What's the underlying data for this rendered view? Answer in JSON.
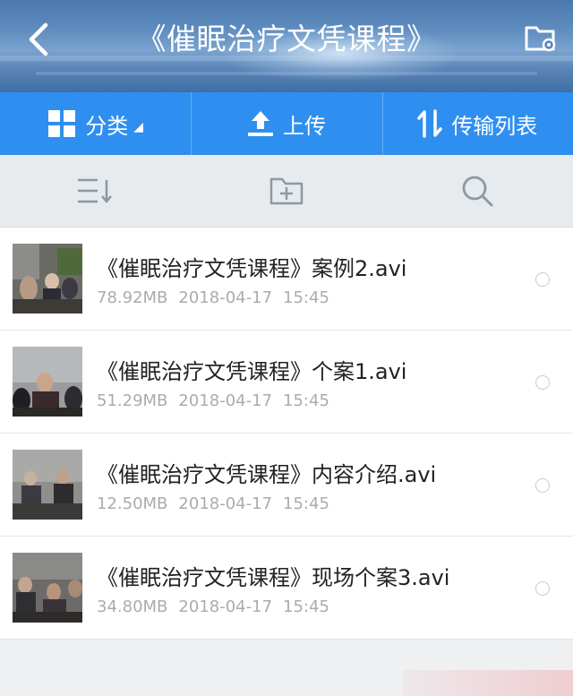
{
  "header": {
    "title": "《催眠治疗文凭课程》"
  },
  "toolbar": {
    "category_label": "分类",
    "upload_label": "上传",
    "transfer_label": "传输列表"
  },
  "colors": {
    "toolbar_bg": "#2f8ff0",
    "icon_gray": "#8a9aa6"
  },
  "files": [
    {
      "name": "《催眠治疗文凭课程》案例2.avi",
      "size": "78.92MB",
      "date": "2018-04-17",
      "time": "15:45"
    },
    {
      "name": "《催眠治疗文凭课程》个案1.avi",
      "size": "51.29MB",
      "date": "2018-04-17",
      "time": "15:45"
    },
    {
      "name": "《催眠治疗文凭课程》内容介绍.avi",
      "size": "12.50MB",
      "date": "2018-04-17",
      "time": "15:45"
    },
    {
      "name": "《催眠治疗文凭课程》现场个案3.avi",
      "size": "34.80MB",
      "date": "2018-04-17",
      "time": "15:45"
    }
  ]
}
